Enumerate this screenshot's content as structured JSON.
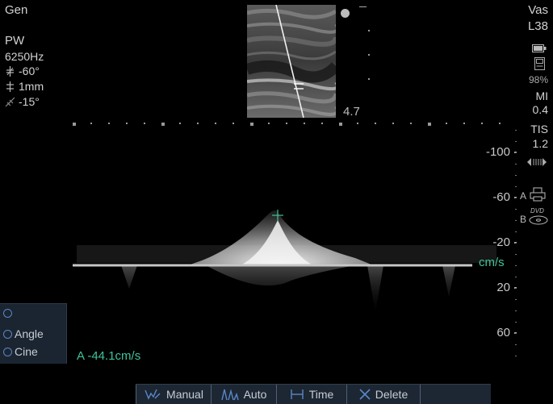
{
  "left_params": {
    "mode": "Gen",
    "pw_label": "PW",
    "pw_freq": "6250Hz",
    "angle": "-60°",
    "gate": "1mm",
    "steer": "-15°"
  },
  "bmode": {
    "depth": "4.7"
  },
  "right_params": {
    "preset": "Vas",
    "probe": "L38",
    "battery_pct": "98%",
    "mi_label": "MI",
    "mi_value": "0.4",
    "tis_label": "TIS",
    "tis_value": "1.2",
    "print_a": "A",
    "print_b": "B",
    "dvd_label": "DVD"
  },
  "spectrum": {
    "scale_labels": [
      "-100",
      "-60",
      "-20",
      "20",
      "60"
    ],
    "scale_values": [
      -100,
      -60,
      -20,
      20,
      60
    ],
    "unit": "cm/s",
    "measurement": "A  -44.1cm/s"
  },
  "side_menu": {
    "items": [
      "",
      "Angle",
      "Cine"
    ]
  },
  "toolbar": {
    "buttons": [
      "Manual",
      "Auto",
      "Time",
      "Delete"
    ]
  },
  "colors": {
    "accent": "#3fc39a",
    "menu_bg": "#1a2531",
    "icon_blue": "#5c86c7"
  }
}
